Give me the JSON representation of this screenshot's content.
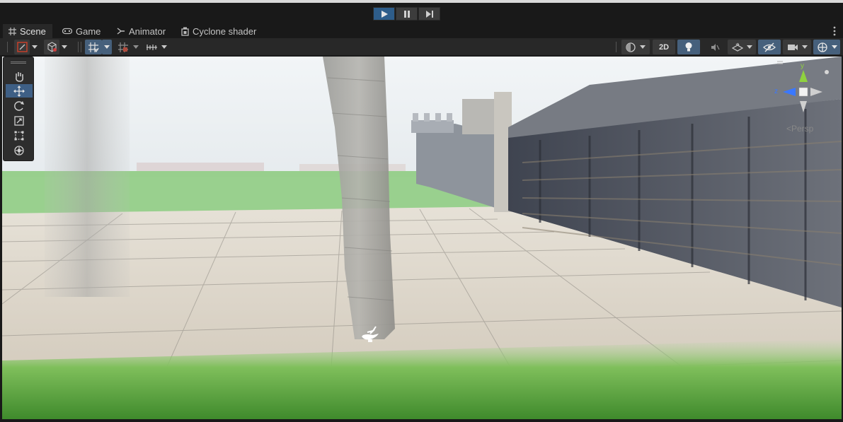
{
  "playbar": {
    "play": "play-icon",
    "pause": "pause-icon",
    "step": "step-icon",
    "active_color": "#2e5d8a"
  },
  "tabs": [
    {
      "label": "Scene",
      "icon": "grid-icon",
      "active": true
    },
    {
      "label": "Game",
      "icon": "gamepad-icon",
      "active": false
    },
    {
      "label": "Animator",
      "icon": "animator-icon",
      "active": false
    },
    {
      "label": "Cyclone shader",
      "icon": "shader-icon",
      "active": false
    }
  ],
  "toolbar": {
    "two_d_label": "2D"
  },
  "tools": [
    "hand-tool",
    "move-tool",
    "rotate-tool",
    "scale-tool",
    "rect-tool",
    "transform-tool"
  ],
  "gizmo": {
    "y_label": "y",
    "z_label": "z",
    "projection": "<Persp",
    "y_color": "#8fd13f",
    "z_color": "#3a78ff"
  },
  "scene": {
    "sky_color": "#e9eef2",
    "grass_color": "#6fb64a",
    "floor_color": "#d8d2c6",
    "wall_color": "#5a5f68"
  }
}
